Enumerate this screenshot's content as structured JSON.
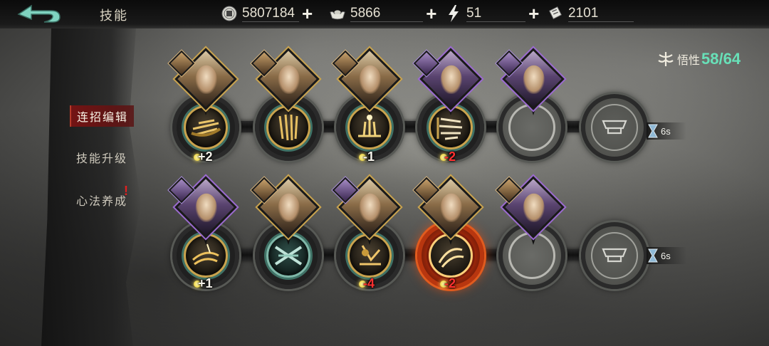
{
  "header": {
    "title": "技能",
    "resources": [
      {
        "icon": "coin-icon",
        "value": "5807184"
      },
      {
        "icon": "ingot-icon",
        "value": "5866"
      },
      {
        "icon": "stamina-lightning-icon",
        "value": "51"
      },
      {
        "icon": "ticket-icon",
        "value": "2101"
      }
    ]
  },
  "menu": {
    "items": [
      {
        "label": "连招编辑",
        "active": true
      },
      {
        "label": "技能升级",
        "active": false
      },
      {
        "label": "心法养成",
        "active": false,
        "alert": "!"
      }
    ]
  },
  "comprehension": {
    "label": "悟性",
    "value": "58/64"
  },
  "combo_rows": [
    {
      "timer": "6s",
      "slots": [
        {
          "cost": "+2",
          "cost_type": "pos"
        },
        {
          "cost": "",
          "cost_type": ""
        },
        {
          "cost": "-1",
          "cost_type": "pos"
        },
        {
          "cost": "-2",
          "cost_type": "neg"
        }
      ]
    },
    {
      "timer": "6s",
      "slots": [
        {
          "cost": "+1",
          "cost_type": "pos"
        },
        {
          "cost": "",
          "cost_type": ""
        },
        {
          "cost": "-4",
          "cost_type": "neg"
        },
        {
          "cost": "-2",
          "cost_type": "neg"
        }
      ]
    }
  ],
  "colors": {
    "accent_gold": "#c9a34e",
    "accent_teal": "#3f7266",
    "comprehension_green": "#68e0b8",
    "negative_red": "#ff3030",
    "active_menu": "#7a1414"
  }
}
